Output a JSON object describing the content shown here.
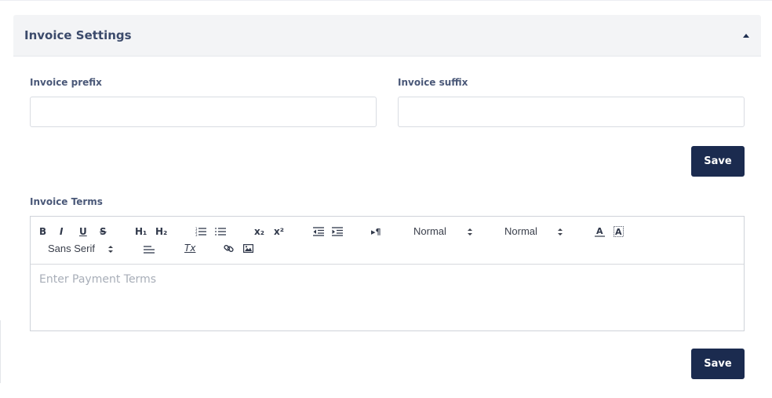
{
  "card": {
    "title": "Invoice Settings",
    "collapse_icon": "caret-up-icon"
  },
  "form": {
    "prefix_label": "Invoice prefix",
    "prefix_value": "",
    "suffix_label": "Invoice suffix",
    "suffix_value": "",
    "save_label": "Save"
  },
  "terms": {
    "label": "Invoice Terms",
    "placeholder": "Enter Payment Terms",
    "save_label": "Save"
  },
  "toolbar": {
    "bold": "B",
    "italic": "I",
    "underline": "U",
    "strike": "S",
    "h1": "H₁",
    "h2": "H₂",
    "subscript": "x₂",
    "superscript": "x²",
    "text_direction": "▸¶",
    "size_picker": "Normal",
    "header_picker": "Normal",
    "font_picker": "Sans Serif",
    "clean": "Tx"
  },
  "colors": {
    "primary": "#1b2b4f",
    "header_bg": "#f3f4f6",
    "border": "#d9dce2",
    "placeholder": "#a8aeb8"
  }
}
